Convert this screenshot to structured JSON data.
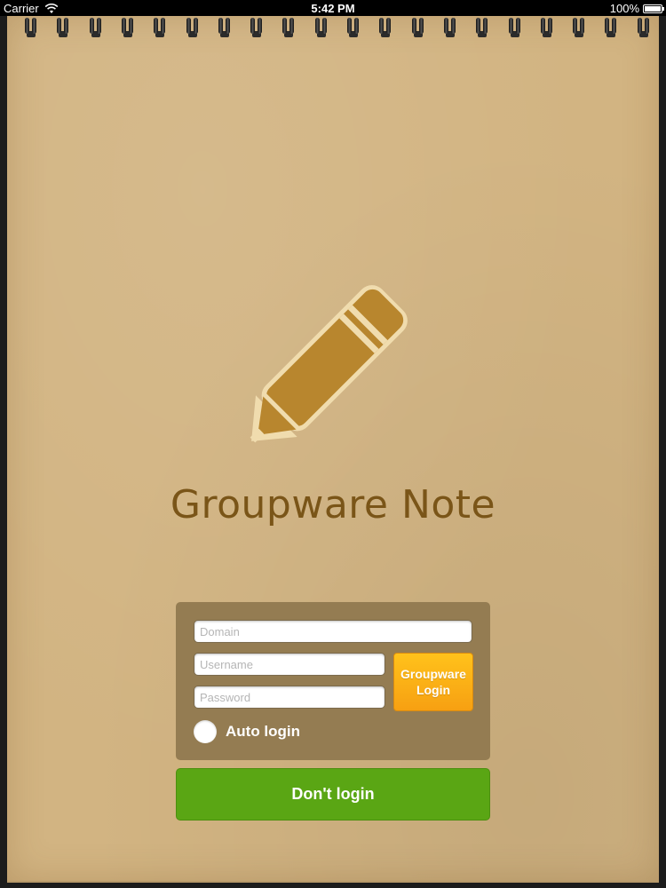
{
  "status_bar": {
    "carrier": "Carrier",
    "time": "5:42 PM",
    "battery": "100%"
  },
  "app": {
    "title": "Groupware Note",
    "logo_icon": "pencil-icon"
  },
  "login": {
    "domain_placeholder": "Domain",
    "username_placeholder": "Username",
    "password_placeholder": "Password",
    "groupware_login_label": "Groupware\nLogin",
    "auto_login_label": "Auto login",
    "auto_login_checked": false
  },
  "dont_login_label": "Don't login",
  "colors": {
    "paper": "#d2b482",
    "title": "#7a5518",
    "panel": "#947c52",
    "groupware_button": "#f7a012",
    "dont_login_button": "#5aa614",
    "pencil": "#b8862e"
  }
}
